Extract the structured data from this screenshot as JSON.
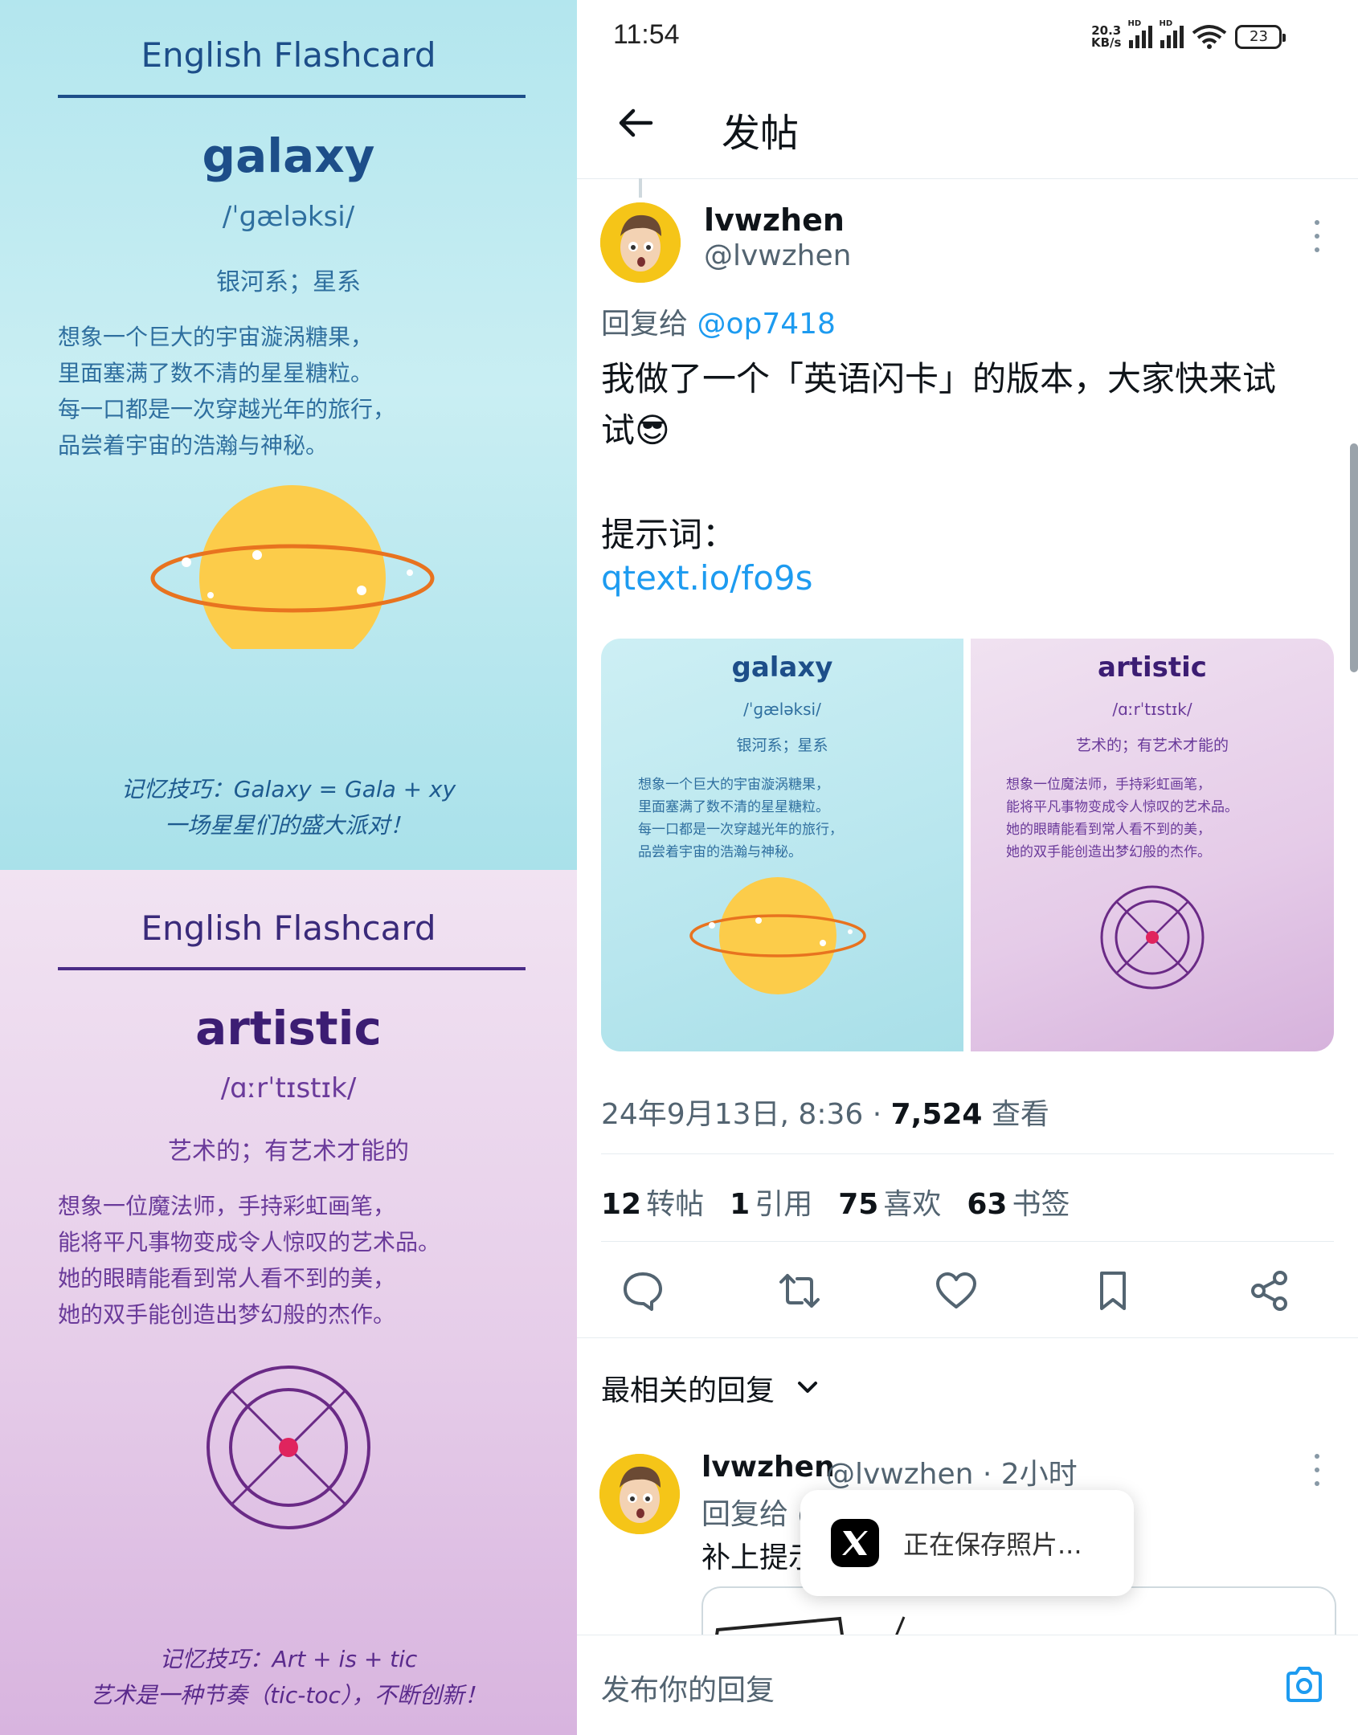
{
  "left_cards": {
    "galaxy": {
      "header": "English Flashcard",
      "word": "galaxy",
      "phonetic": "/ˈɡæləksi/",
      "meaning": "银河系；星系",
      "story": [
        "想象一个巨大的宇宙漩涡糖果，",
        "里面塞满了数不清的星星糖粒。",
        "每一口都是一次穿越光年的旅行，",
        "品尝着宇宙的浩瀚与神秘。"
      ],
      "tip": [
        "记忆技巧：Galaxy = Gala + xy",
        "一场星星们的盛大派对！"
      ]
    },
    "artistic": {
      "header": "English Flashcard",
      "word": "artistic",
      "phonetic": "/ɑːrˈtɪstɪk/",
      "meaning": "艺术的；有艺术才能的",
      "story": [
        "想象一位魔法师，手持彩虹画笔，",
        "能将平凡事物变成令人惊叹的艺术品。",
        "她的眼睛能看到常人看不到的美，",
        "她的双手能创造出梦幻般的杰作。"
      ],
      "tip": [
        "记忆技巧：Art + is + tic",
        "艺术是一种节奏（tic-toc），不断创新！"
      ]
    }
  },
  "status_bar": {
    "time": "11:54",
    "net_rate_top": "20.3",
    "net_rate_bottom": "KB/s",
    "hd": "HD",
    "battery": "23"
  },
  "topbar": {
    "title": "发帖",
    "back_icon": "arrow-left-icon"
  },
  "post": {
    "author_name": "lvwzhen",
    "author_handle": "@lvwzhen",
    "reply_prefix": "回复给 ",
    "reply_mention": "@op7418",
    "text_line1": "我做了一个「英语闪卡」的版本，大家快来试",
    "text_line2": "试😎",
    "prompt_label": "提示词：",
    "prompt_link": "qtext.io/fo9s",
    "timestamp": "24年9月13日, 8:36 · ",
    "views_num": "7,524",
    "views_label": " 查看",
    "stats": [
      {
        "num": "12",
        "label": "转帖"
      },
      {
        "num": "1",
        "label": "引用"
      },
      {
        "num": "75",
        "label": "喜欢"
      },
      {
        "num": "63",
        "label": "书签"
      }
    ]
  },
  "media_tiles": {
    "galaxy": {
      "word": "galaxy",
      "phonetic": "/ˈɡæləksi/",
      "meaning": "银河系；星系",
      "story": [
        "想象一个巨大的宇宙漩涡糖果，",
        "里面塞满了数不清的星星糖粒。",
        "每一口都是一次穿越光年的旅行，",
        "品尝着宇宙的浩瀚与神秘。"
      ]
    },
    "artistic": {
      "word": "artistic",
      "phonetic": "/ɑːrˈtɪstɪk/",
      "meaning": "艺术的；有艺术才能的",
      "story": [
        "想象一位魔法师，手持彩虹画笔，",
        "能将平凡事物变成令人惊叹的艺术品。",
        "她的眼睛能看到常人看不到的美，",
        "她的双手能创造出梦幻般的杰作。"
      ]
    }
  },
  "actions": {
    "reply_icon": "comment-icon",
    "retweet_icon": "retweet-icon",
    "like_icon": "heart-icon",
    "bookmark_icon": "bookmark-icon",
    "share_icon": "share-icon"
  },
  "replies_section": {
    "sort_label": "最相关的回复",
    "reply": {
      "name": "lvwzhen",
      "handle": "@lvwzhen · 2小时",
      "reply_prefix": "回复给 @",
      "text": "补上提示"
    }
  },
  "toast": {
    "text": "正在保存照片..."
  },
  "compose": {
    "placeholder": "发布你的回复"
  },
  "colors": {
    "accent": "#1d9bf0",
    "galaxy_title": "#1d4e89",
    "artistic_title": "#3c1d73",
    "planet": "#fccc4a",
    "ring": "#e8731f",
    "target": "#6a2a86",
    "target_center": "#e0245e"
  }
}
